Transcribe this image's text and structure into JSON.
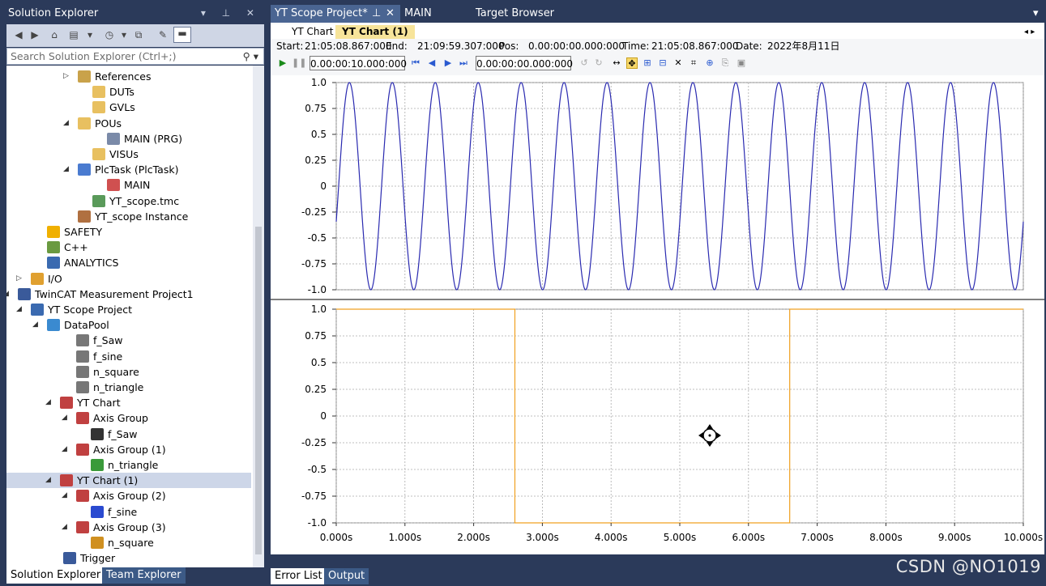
{
  "solution_explorer": {
    "title": "Solution Explorer",
    "search_placeholder": "Search Solution Explorer (Ctrl+;)",
    "tree": [
      {
        "label": "References",
        "expander": "▷",
        "icon": "folder-icon",
        "color": "#c9a24a"
      },
      {
        "label": "DUTs",
        "expander": "",
        "icon": "folder-icon",
        "color": "#e8c060"
      },
      {
        "label": "GVLs",
        "expander": "",
        "icon": "folder-icon",
        "color": "#e8c060"
      },
      {
        "label": "POUs",
        "expander": "◢",
        "icon": "folder-open-icon",
        "color": "#e8c060"
      },
      {
        "label": "MAIN (PRG)",
        "expander": "",
        "icon": "program-icon",
        "color": "#7a8aa8"
      },
      {
        "label": "VISUs",
        "expander": "",
        "icon": "folder-icon",
        "color": "#e8c060"
      },
      {
        "label": "PlcTask (PlcTask)",
        "expander": "◢",
        "icon": "task-icon",
        "color": "#4a7bd0"
      },
      {
        "label": "MAIN",
        "expander": "",
        "icon": "program-ref-icon",
        "color": "#d05050"
      },
      {
        "label": "YT_scope.tmc",
        "expander": "",
        "icon": "tmc-icon",
        "color": "#5a9a5a"
      },
      {
        "label": "YT_scope Instance",
        "expander": "",
        "icon": "instance-icon",
        "color": "#b07040"
      },
      {
        "label": "SAFETY",
        "expander": "",
        "icon": "safety-icon",
        "color": "#f0b000"
      },
      {
        "label": "C++",
        "expander": "",
        "icon": "cpp-icon",
        "color": "#6a9a40"
      },
      {
        "label": "ANALYTICS",
        "expander": "",
        "icon": "analytics-icon",
        "color": "#3a6ab0"
      },
      {
        "label": "I/O",
        "expander": "▷",
        "icon": "io-icon",
        "color": "#e0a030"
      },
      {
        "label": "TwinCAT Measurement Project1",
        "expander": "◢",
        "icon": "measurement-project-icon",
        "color": "#3a5a9a"
      },
      {
        "label": "YT Scope Project",
        "expander": "◢",
        "icon": "scope-project-icon",
        "color": "#3a6ab0"
      },
      {
        "label": "DataPool",
        "expander": "◢",
        "icon": "datapool-icon",
        "color": "#3a8ad0"
      },
      {
        "label": "f_Saw",
        "expander": "",
        "icon": "float64-icon",
        "color": "#777"
      },
      {
        "label": "f_sine",
        "expander": "",
        "icon": "float64-icon",
        "color": "#777"
      },
      {
        "label": "n_square",
        "expander": "",
        "icon": "int16-icon",
        "color": "#777"
      },
      {
        "label": "n_triangle",
        "expander": "",
        "icon": "int16-icon",
        "color": "#777"
      },
      {
        "label": "YT Chart",
        "expander": "◢",
        "icon": "yt-chart-icon",
        "color": "#c04040"
      },
      {
        "label": "Axis Group",
        "expander": "◢",
        "icon": "axis-group-icon",
        "color": "#c04040"
      },
      {
        "label": "f_Saw",
        "expander": "",
        "icon": "channel-icon",
        "color": "#333"
      },
      {
        "label": "Axis Group (1)",
        "expander": "◢",
        "icon": "axis-group-icon",
        "color": "#c04040"
      },
      {
        "label": "n_triangle",
        "expander": "",
        "icon": "channel-icon",
        "color": "#3a9a3a"
      },
      {
        "label": "YT Chart (1)",
        "expander": "◢",
        "icon": "yt-chart-icon",
        "color": "#c04040"
      },
      {
        "label": "Axis Group (2)",
        "expander": "◢",
        "icon": "axis-group-icon",
        "color": "#c04040"
      },
      {
        "label": "f_sine",
        "expander": "",
        "icon": "channel-icon",
        "color": "#2a4ad0"
      },
      {
        "label": "Axis Group (3)",
        "expander": "◢",
        "icon": "axis-group-icon",
        "color": "#c04040"
      },
      {
        "label": "n_square",
        "expander": "",
        "icon": "channel-icon",
        "color": "#d09020"
      },
      {
        "label": "Trigger",
        "expander": "",
        "icon": "trigger-icon",
        "color": "#3a5a9a"
      }
    ],
    "bottom_tabs": [
      "Solution Explorer",
      "Team Explorer"
    ]
  },
  "document_tabs": [
    "YT Scope Project*",
    "MAIN",
    "Target Browser"
  ],
  "scope": {
    "tabs": [
      "YT Chart",
      "YT Chart (1)"
    ],
    "info": {
      "start_label": "Start:",
      "start": "21:05:08.867:000",
      "end_label": "End:",
      "end": "21:09:59.307:000",
      "pos_label": "Pos:",
      "pos": "0.00:00:00.000:000",
      "time_label": "Time:",
      "time": "21:05:08.867:000",
      "date_label": "Date:",
      "date": "2022年8月11日"
    },
    "span_input": "0.00:00:10.000:000",
    "pos_input": "0.00:00:00.000:000"
  },
  "bottom_panel_tabs": [
    "Error List",
    "Output"
  ],
  "watermark": "CSDN @NO1019",
  "chart_data": [
    {
      "type": "line",
      "series": [
        {
          "name": "f_sine",
          "color": "#2a2ab0",
          "function": "sine",
          "amplitude": 1.0,
          "period_s": 0.625,
          "phase_at_0": -0.35
        }
      ],
      "ylim": [
        -1.0,
        1.0
      ],
      "yticks": [
        "1.0",
        "0.75",
        "0.5",
        "0.25",
        "0",
        "-0.25",
        "-0.5",
        "-0.75",
        "-1.0"
      ],
      "xlim": [
        0,
        10
      ],
      "grid": true
    },
    {
      "type": "line",
      "series": [
        {
          "name": "n_square",
          "color": "#f0a020",
          "function": "square",
          "high": 1.0,
          "low": -1.0,
          "x": [
            0,
            2.6,
            2.6,
            6.6,
            6.6,
            10
          ],
          "y": [
            1.0,
            1.0,
            -1.0,
            -1.0,
            1.0,
            1.0
          ]
        }
      ],
      "ylim": [
        -1.0,
        1.0
      ],
      "yticks": [
        "1.0",
        "0.75",
        "0.5",
        "0.25",
        "0",
        "-0.25",
        "-0.5",
        "-0.75",
        "-1.0"
      ],
      "xlim": [
        0,
        10
      ],
      "xticks": [
        "0.000s",
        "1.000s",
        "2.000s",
        "3.000s",
        "4.000s",
        "5.000s",
        "6.000s",
        "7.000s",
        "8.000s",
        "9.000s",
        "10.000s"
      ],
      "grid": true
    }
  ]
}
